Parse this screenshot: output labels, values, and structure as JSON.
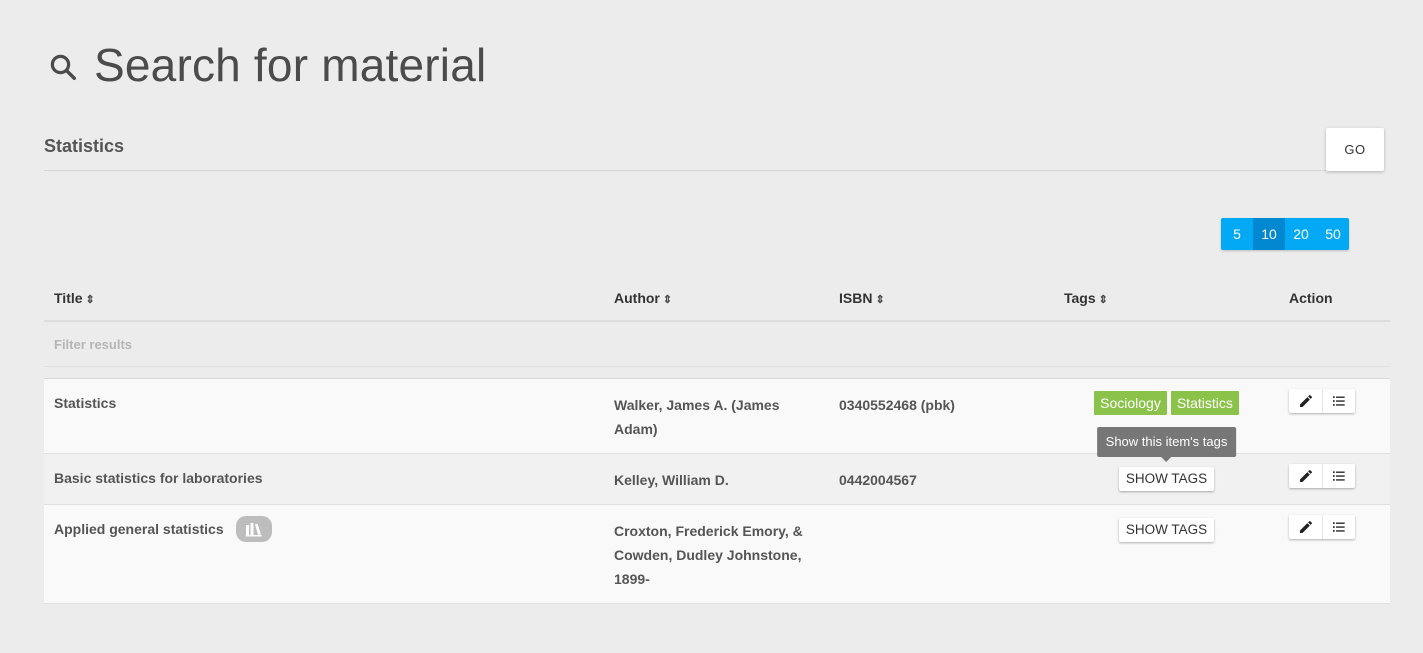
{
  "page": {
    "title": "Search for material"
  },
  "search": {
    "value": "Statistics",
    "go_label": "GO"
  },
  "pagination": {
    "options": [
      "5",
      "10",
      "20",
      "50"
    ],
    "selected": "10"
  },
  "table": {
    "columns": {
      "title": "Title",
      "author": "Author",
      "isbn": "ISBN",
      "tags": "Tags",
      "action": "Action"
    },
    "sort_icon": "⇕",
    "filter_placeholder": "Filter results",
    "rows": [
      {
        "title": "Statistics",
        "author": "Walker, James A. (James Adam)",
        "isbn": "0340552468 (pbk)",
        "tags": [
          "Sociology",
          "Statistics"
        ],
        "tooltip": "Show this item's tags"
      },
      {
        "title": "Basic statistics for laboratories",
        "author": "Kelley, William D.",
        "isbn": "0442004567",
        "show_tags_label": "SHOW TAGS"
      },
      {
        "title": "Applied general statistics",
        "author": "Croxton, Frederick Emory, & Cowden, Dudley Johnstone, 1899-",
        "isbn": "",
        "show_tags_label": "SHOW TAGS",
        "badge_icon": "library-books-icon"
      }
    ]
  },
  "colors": {
    "background": "#ececec",
    "page_size_button": "#03a9f4",
    "page_size_active": "#0288d1",
    "tag": "#8bc34a",
    "tooltip": "#777777"
  }
}
